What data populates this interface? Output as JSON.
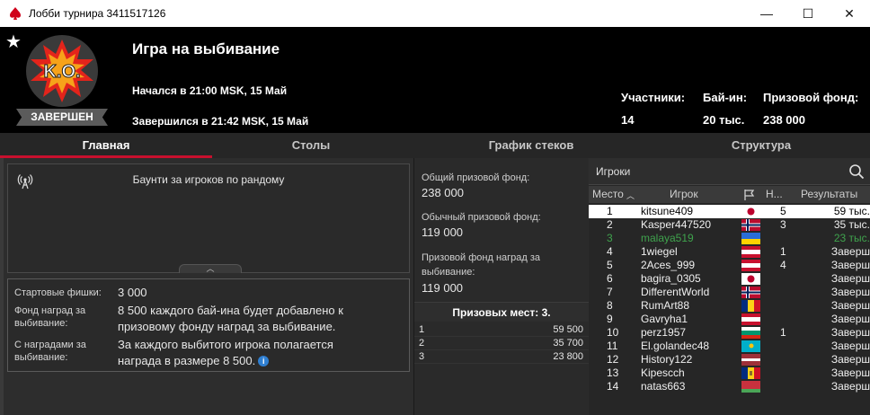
{
  "window": {
    "title": "Лобби турнира 3411517126",
    "minimize": "—",
    "maximize": "☐",
    "close": "✕"
  },
  "header": {
    "status": "ЗАВЕРШЕН",
    "tournament_name": "Игра на выбивание",
    "started": "Начался в 21:00 MSK, 15 Май",
    "ended": "Завершился в 21:42 MSK, 15 Май",
    "logo_text": "K.O.",
    "stats": [
      {
        "label": "Участники:",
        "value": "14"
      },
      {
        "label": "Бай-ин:",
        "value": "20 тыс."
      },
      {
        "label": "Призовой фонд:",
        "value": "238 000"
      }
    ]
  },
  "tabs": [
    "Главная",
    "Столы",
    "График стеков",
    "Структура"
  ],
  "bounty": {
    "text": "Баунти за игроков по рандому",
    "collapse": "︿"
  },
  "info": {
    "starting_chips_label": "Стартовые фишки:",
    "starting_chips_value": "3 000",
    "bounty_fund_label_1": "Фонд наград за",
    "bounty_fund_label_2": "выбивание:",
    "bounty_fund_value_1": "8 500 каждого бай-ина будет добавлено к",
    "bounty_fund_value_2": "призовому фонду наград за выбивание.",
    "with_bounties_label_1": "С наградами за",
    "with_bounties_label_2": "выбивание:",
    "with_bounties_value_1": "За каждого выбитого игрока полагается",
    "with_bounties_value_2": "награда в размере 8 500.",
    "info_icon": "i"
  },
  "prize": {
    "total_label": "Общий призовой фонд:",
    "total_value": "238 000",
    "regular_label": "Обычный призовой фонд:",
    "regular_value": "119 000",
    "bounty_label_1": "Призовой фонд наград за",
    "bounty_label_2": "выбивание:",
    "bounty_value": "119 000",
    "places_header": "Призовых мест: 3.",
    "places": [
      {
        "place": "1",
        "amount": "59 500"
      },
      {
        "place": "2",
        "amount": "35 700"
      },
      {
        "place": "3",
        "amount": "23 800"
      }
    ]
  },
  "players": {
    "search_label": "Игроки",
    "columns": {
      "place": "Место",
      "player": "Игрок",
      "knockouts": "Н...",
      "results": "Результаты"
    },
    "rows": [
      {
        "place": "1",
        "name": "kitsune409",
        "flag": "japan",
        "ko": "5",
        "result": "59 тыс.",
        "style": "hl"
      },
      {
        "place": "2",
        "name": "Kasper447520",
        "flag": "norway",
        "ko": "3",
        "result": "35 тыс.",
        "style": ""
      },
      {
        "place": "3",
        "name": "malaya519",
        "flag": "ukraine",
        "ko": "",
        "result": "23 тыс.",
        "style": "green"
      },
      {
        "place": "4",
        "name": "1wiegel",
        "flag": "austria",
        "ko": "1",
        "result": "Заверш",
        "style": ""
      },
      {
        "place": "5",
        "name": "2Aces_999",
        "flag": "austria",
        "ko": "4",
        "result": "Заверш",
        "style": ""
      },
      {
        "place": "6",
        "name": "bagira_0305",
        "flag": "japan",
        "ko": "",
        "result": "Заверш",
        "style": ""
      },
      {
        "place": "7",
        "name": "DifferentWorld",
        "flag": "norway",
        "ko": "",
        "result": "Заверш",
        "style": ""
      },
      {
        "place": "8",
        "name": "RumArt88",
        "flag": "romania",
        "ko": "",
        "result": "Заверш",
        "style": ""
      },
      {
        "place": "9",
        "name": "Gavryha1",
        "flag": "austria",
        "ko": "",
        "result": "Заверш",
        "style": ""
      },
      {
        "place": "10",
        "name": "perz1957",
        "flag": "bulgaria",
        "ko": "1",
        "result": "Заверш",
        "style": ""
      },
      {
        "place": "11",
        "name": "El.golandec48",
        "flag": "kazakhstan",
        "ko": "",
        "result": "Заверш",
        "style": ""
      },
      {
        "place": "12",
        "name": "History122",
        "flag": "latvia",
        "ko": "",
        "result": "Заверш",
        "style": ""
      },
      {
        "place": "13",
        "name": "Kipescch",
        "flag": "moldova",
        "ko": "",
        "result": "Заверш",
        "style": ""
      },
      {
        "place": "14",
        "name": "natas663",
        "flag": "belarus",
        "ko": "",
        "result": "Заверш",
        "style": ""
      }
    ]
  },
  "colors": {
    "accent": "#c8102e",
    "winner_row": "#ffffff",
    "in_money": "#3fa34d"
  }
}
